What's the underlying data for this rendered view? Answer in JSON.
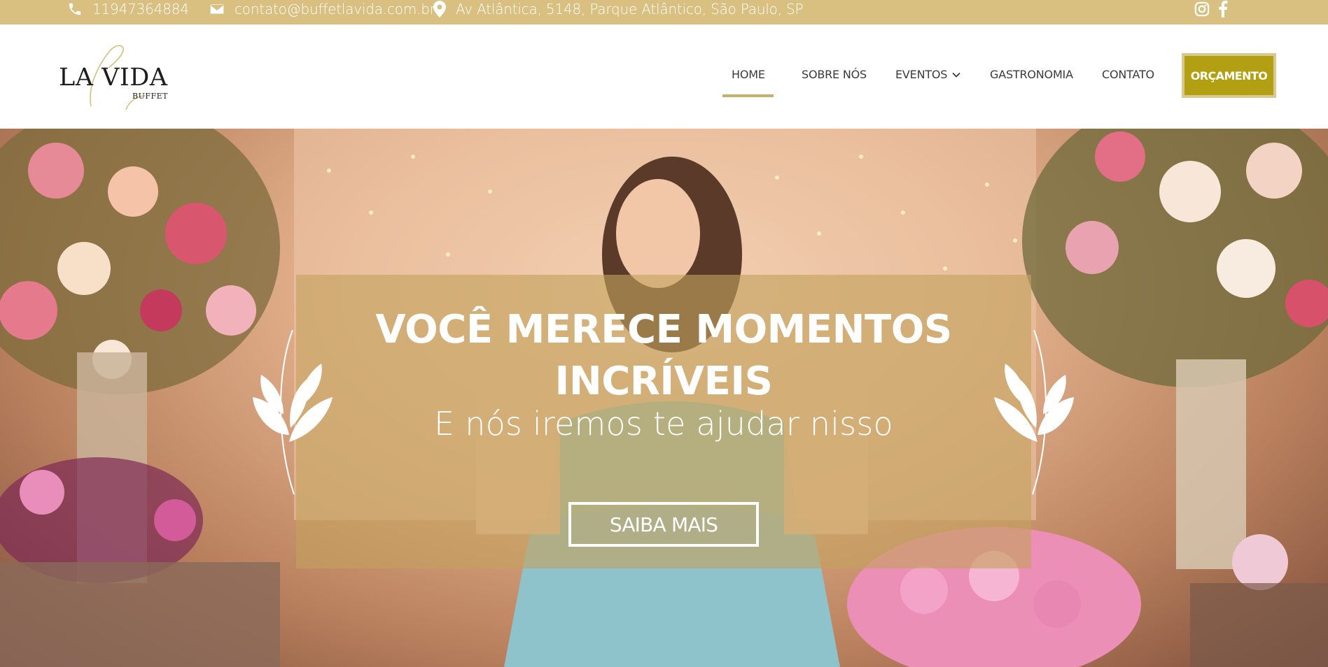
{
  "topbar": {
    "phone": "11947364884",
    "email": "contato@buffetlavida.com.br",
    "address": "Av Atlântica, 5148, Parque Atlântico, São Paulo, SP",
    "icons": [
      "phone-icon",
      "envelope-icon",
      "map-pin-icon",
      "instagram-icon",
      "facebook-icon"
    ]
  },
  "logo": {
    "title": "LA VIDA",
    "subtitle": "BUFFET"
  },
  "nav": {
    "items": [
      {
        "label": "HOME",
        "active": true
      },
      {
        "label": "SOBRE NÓS"
      },
      {
        "label": "EVENTOS",
        "has_dropdown": true
      },
      {
        "label": "GASTRONOMIA"
      },
      {
        "label": "CONTATO"
      }
    ],
    "cta": "ORÇAMENTO"
  },
  "hero": {
    "headline": "VOCÊ MERECE MOMENTOS INCRÍVEIS",
    "subheadline": "E nós iremos te ajudar nisso",
    "button": "SAIBA MAIS"
  },
  "colors": {
    "topbar": "#d9bf80",
    "accent_gold": "#c8ad6b",
    "cta_olive": "#b3a012",
    "panel_overlay": "#c4a15c"
  }
}
